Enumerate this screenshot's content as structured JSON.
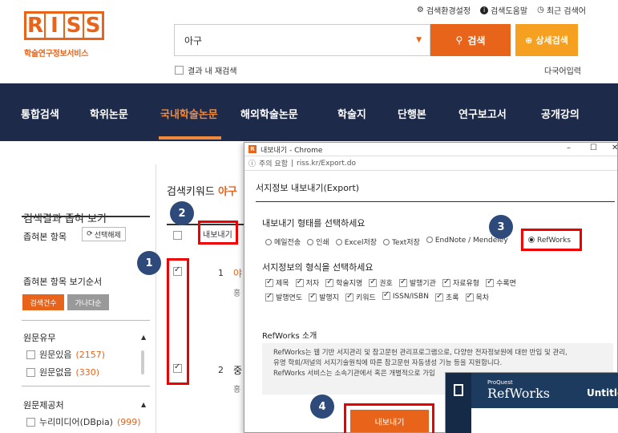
{
  "logo": {
    "letters": [
      "R",
      "I",
      "S",
      "S"
    ],
    "subtitle": "학술연구정보서비스"
  },
  "util_links": [
    {
      "icon": "gear-icon",
      "label": "검색환경설정"
    },
    {
      "icon": "info-icon",
      "label": "검색도움말"
    },
    {
      "icon": "clock-icon",
      "label": "최근 검색어"
    }
  ],
  "search": {
    "value": "아구",
    "button": "검색",
    "advanced_button": "상세검색",
    "re_search_label": "결과 내 재검색",
    "multilang": "다국어입력"
  },
  "nav": {
    "items": [
      "통합검색",
      "학위논문",
      "국내학술논문",
      "해외학술논문",
      "학술지",
      "단행본",
      "연구보고서",
      "공개강의"
    ],
    "active_index": 2
  },
  "sidebar": {
    "title": "검색결과 좁혀 보기",
    "filter_label": "좁혀본 항목",
    "reset_button": "선택해제",
    "order_label": "좁혀본 항목 보기순서",
    "sort_buttons": [
      "검색건수",
      "가나다순"
    ],
    "sections": [
      {
        "title": "원문유무",
        "rows": [
          {
            "label": "원문있음",
            "count": "(2157)"
          },
          {
            "label": "원문없음",
            "count": "(330)"
          }
        ]
      },
      {
        "title": "원문제공처",
        "rows": [
          {
            "label": "누리미디어(DBpia)",
            "count": "(999)"
          }
        ]
      }
    ]
  },
  "results": {
    "keyword_label": "검색키워드",
    "keyword": "야구",
    "export_button": "내보내기",
    "items": [
      {
        "num": "1",
        "title_fragment": "야",
        "sub_fragment": "홍"
      },
      {
        "num": "2",
        "title_fragment": "중",
        "sub_fragment": "홍"
      }
    ]
  },
  "step_badges": [
    "1",
    "2",
    "3",
    "4"
  ],
  "popup": {
    "window_title": "내보내기 - Chrome",
    "url_warning": "주의 요함",
    "url": "riss.kr/Export.do",
    "heading": "서지정보 내보내기(Export)",
    "type_label": "내보내기 형태를 선택하세요",
    "types": [
      "메일전송",
      "인쇄",
      "Excel저장",
      "Text저장",
      "EndNote / Mendeley",
      "RefWorks"
    ],
    "type_selected": "RefWorks",
    "format_label": "서지정보의 형식을 선택하세요",
    "formats_row1": [
      "제목",
      "저자",
      "학술지명",
      "권호",
      "발행기관",
      "자료유형",
      "수록면"
    ],
    "formats_row2": [
      "발행연도",
      "발행지",
      "키워드",
      "ISSN/ISBN",
      "초록",
      "목차"
    ],
    "refworks_title": "RefWorks 소개",
    "refworks_desc": [
      "RefWorks는 웹 기반 서지관리 및 참고문헌 관리프로그램으로, 다양한 전자정보원에 대한 반입 및 관리,",
      "유명 학회/저널의 서지기술원칙에 따른 참고문헌 자동생성 기능 등을 지원합니다.",
      "RefWorks 서비스는 소속기관에서 혹은 개별적으로 가입"
    ],
    "export_button": "내보내기"
  },
  "refworks_window": {
    "proquest": "ProQuest",
    "name": "RefWorks",
    "doc_title": "Untitled"
  },
  "colors": {
    "accent": "#e8641b",
    "nav_bg": "#1e2a4a",
    "highlight": "#ee0000",
    "badge": "#2e4a7a"
  }
}
